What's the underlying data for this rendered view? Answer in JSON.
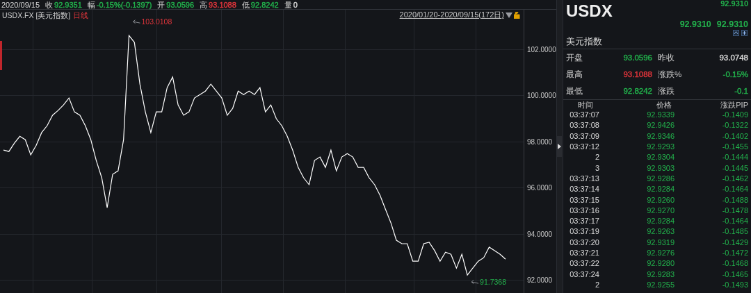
{
  "header": {
    "date": "2020/09/15",
    "stats": [
      {
        "label": "收",
        "value": "92.9351",
        "color": "#22b24c"
      },
      {
        "label": "幅",
        "value": "-0.15%(-0.1397)",
        "color": "#22b24c"
      },
      {
        "label": "开",
        "value": "93.0596",
        "color": "#22b24c"
      },
      {
        "label": "高",
        "value": "93.1088",
        "color": "#e0353b"
      },
      {
        "label": "低",
        "value": "92.8242",
        "color": "#22b24c"
      },
      {
        "label": "量",
        "value": "0",
        "color": "#d8d8d8"
      }
    ]
  },
  "chart": {
    "symbol": "USDX.FX [美元指数]",
    "period": "日线",
    "range": "2020/01/20-2020/09/15(172日)",
    "chart_data": {
      "type": "line",
      "grid": true,
      "ylim": [
        91.4,
        103.72
      ],
      "yticks": [
        {
          "value": 92,
          "label": "92.0000"
        },
        {
          "value": 94,
          "label": "94.0000"
        },
        {
          "value": 96,
          "label": "96.0000"
        },
        {
          "value": 98,
          "label": "98.0000"
        },
        {
          "value": 100,
          "label": "100.0000"
        },
        {
          "value": 102,
          "label": "102.0000"
        }
      ],
      "series": [
        {
          "color": "#ffffff",
          "values": [
            97.63,
            97.57,
            97.93,
            98.23,
            98.08,
            97.42,
            97.84,
            98.39,
            98.69,
            99.14,
            99.35,
            99.59,
            99.89,
            99.29,
            99.14,
            98.69,
            98.08,
            97.18,
            96.43,
            95.13,
            96.58,
            96.73,
            98.08,
            102.6,
            102.3,
            100.49,
            99.29,
            98.39,
            99.29,
            99.29,
            100.34,
            100.8,
            99.59,
            99.14,
            99.29,
            99.89,
            100.04,
            100.19,
            100.49,
            100.19,
            99.89,
            99.14,
            99.44,
            100.19,
            100.04,
            100.19,
            100.04,
            100.34,
            99.29,
            99.59,
            98.99,
            98.69,
            98.23,
            97.63,
            96.88,
            96.43,
            96.13,
            97.18,
            97.33,
            96.88,
            97.63,
            96.73,
            97.33,
            97.48,
            97.33,
            96.88,
            96.88,
            96.43,
            96.13,
            95.67,
            95.07,
            94.47,
            93.72,
            93.57,
            93.57,
            92.81,
            92.81,
            93.57,
            93.63,
            93.27,
            92.81,
            93.2,
            93.11,
            92.51,
            93.11,
            92.21,
            92.51,
            92.81,
            92.96,
            93.42,
            93.27,
            93.11,
            92.9
          ]
        }
      ],
      "annotations": [
        "103.0108",
        "91.7368"
      ]
    }
  },
  "quote": {
    "top_price": "92.9310",
    "symbol": "USDX",
    "bid": "92.9310",
    "ask": "92.9310",
    "name": "美元指数",
    "stats": [
      {
        "label": "开盘",
        "value": "93.0596",
        "color": "#22b24c"
      },
      {
        "label": "昨收",
        "value": "93.0748",
        "color": "#d8d8d8"
      },
      {
        "label": "最高",
        "value": "93.1088",
        "color": "#e0353b"
      },
      {
        "label": "涨跌%",
        "value": "-0.15%",
        "color": "#22b24c"
      },
      {
        "label": "最低",
        "value": "92.8242",
        "color": "#22b24c"
      },
      {
        "label": "涨跌",
        "value": "-0.1",
        "color": "#22b24c"
      }
    ],
    "columns": [
      "时间",
      "价格",
      "涨跌PIP"
    ],
    "ticks": [
      {
        "time": "03:37:07",
        "price": "92.9339",
        "change": "-0.1409"
      },
      {
        "time": "03:37:08",
        "price": "92.9426",
        "change": "-0.1322"
      },
      {
        "time": "03:37:09",
        "price": "92.9346",
        "change": "-0.1402"
      },
      {
        "time": "03:37:12",
        "price": "92.9293",
        "change": "-0.1455"
      },
      {
        "time": "2",
        "price": "92.9304",
        "change": "-0.1444"
      },
      {
        "time": "3",
        "price": "92.9303",
        "change": "-0.1445"
      },
      {
        "time": "03:37:13",
        "price": "92.9286",
        "change": "-0.1462"
      },
      {
        "time": "03:37:14",
        "price": "92.9284",
        "change": "-0.1464"
      },
      {
        "time": "03:37:15",
        "price": "92.9260",
        "change": "-0.1488"
      },
      {
        "time": "03:37:16",
        "price": "92.9270",
        "change": "-0.1478"
      },
      {
        "time": "03:37:17",
        "price": "92.9284",
        "change": "-0.1464"
      },
      {
        "time": "03:37:19",
        "price": "92.9263",
        "change": "-0.1485"
      },
      {
        "time": "03:37:20",
        "price": "92.9319",
        "change": "-0.1429"
      },
      {
        "time": "03:37:21",
        "price": "92.9276",
        "change": "-0.1472"
      },
      {
        "time": "03:37:22",
        "price": "92.9280",
        "change": "-0.1468"
      },
      {
        "time": "03:37:24",
        "price": "92.9283",
        "change": "-0.1465"
      },
      {
        "time": "2",
        "price": "92.9255",
        "change": "-0.1493"
      }
    ]
  }
}
